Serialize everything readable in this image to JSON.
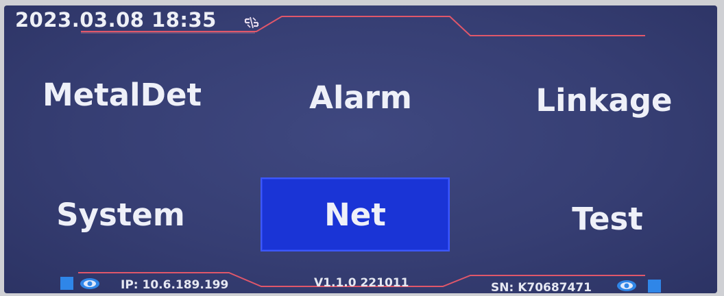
{
  "header": {
    "datetime": "2023.03.08 18:35",
    "link_icon": "link-broken-icon"
  },
  "menu": {
    "items": [
      {
        "label": "MetalDet",
        "selected": false
      },
      {
        "label": "Alarm",
        "selected": false
      },
      {
        "label": "Linkage",
        "selected": false
      },
      {
        "label": "System",
        "selected": false
      },
      {
        "label": "Net",
        "selected": true
      },
      {
        "label": "Test",
        "selected": false
      }
    ]
  },
  "status_bar": {
    "ip": "IP: 10.6.189.199",
    "version": "V1.1.0 221011",
    "sn": "SN: K70687471",
    "left_icons": [
      "status-square-icon",
      "eye-icon"
    ],
    "right_icons": [
      "eye-icon",
      "status-square-icon"
    ]
  },
  "colors": {
    "background": "#363e73",
    "selected": "#1a34d6",
    "accent_line": "#e0576a",
    "text": "#eef0f8",
    "status_icon": "#2f86e8"
  }
}
